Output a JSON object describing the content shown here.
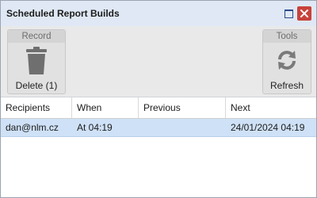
{
  "window": {
    "title": "Scheduled Report Builds",
    "maximize_icon": "maximize-icon",
    "close_icon": "close-icon"
  },
  "ribbon": {
    "groups": [
      {
        "title": "Record",
        "button": {
          "label": "Delete (1)",
          "icon": "trash-icon"
        }
      },
      {
        "title": "Tools",
        "button": {
          "label": "Refresh",
          "icon": "refresh-icon"
        }
      }
    ]
  },
  "table": {
    "columns": [
      "Recipients",
      "When",
      "Previous",
      "Next"
    ],
    "rows": [
      {
        "recipients": "dan@nlm.cz",
        "when": "At 04:19",
        "previous": "",
        "next": "24/01/2024 04:19",
        "selected": true
      }
    ]
  },
  "colors": {
    "titlebar_bg": "#dfe8f4",
    "selected_row_bg": "#cfe1f6",
    "close_button_bg": "#c8423a"
  }
}
